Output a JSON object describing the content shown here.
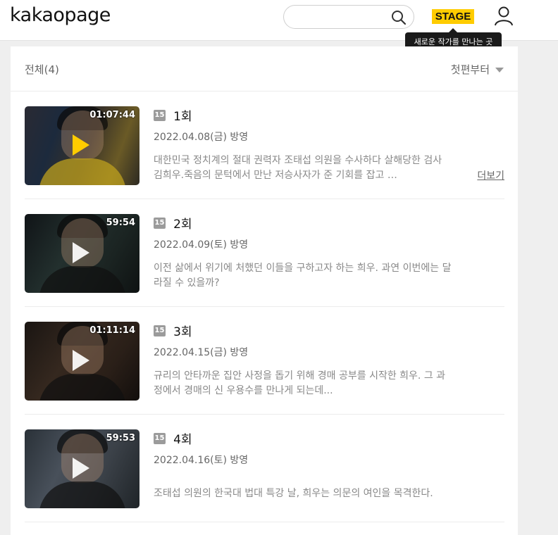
{
  "header": {
    "logo": "kakaopage",
    "search": {
      "value": "",
      "placeholder": ""
    },
    "stage_label": "STAGE",
    "stage_tooltip": "새로운 작가를 만나는 곳"
  },
  "list": {
    "count_label": "전체(4)",
    "sort_label": "첫편부터"
  },
  "episodes": [
    {
      "duration": "01:07:44",
      "age": "15",
      "title": "1회",
      "date": "2022.04.08(금) 방영",
      "description": "대한민국 정치계의 절대 권력자 조태섭 의원을 수사하다 살해당한 검사 김희우.죽음의 문턱에서 만난 저승사자가 준 기회를 잡고 …",
      "more_label": "더보기"
    },
    {
      "duration": "59:54",
      "age": "15",
      "title": "2회",
      "date": "2022.04.09(토) 방영",
      "description": "이전 삶에서 위기에 처했던 이들을 구하고자 하는 희우. 과연 이번에는 달라질 수 있을까?"
    },
    {
      "duration": "01:11:14",
      "age": "15",
      "title": "3회",
      "date": "2022.04.15(금) 방영",
      "description": "규리의 안타까운 집안 사정을 돕기 위해 경매 공부를 시작한 희우. 그 과정에서 경매의 신 우용수를 만나게 되는데..."
    },
    {
      "duration": "59:53",
      "age": "15",
      "title": "4회",
      "date": "2022.04.16(토) 방영",
      "description": "조태섭 의원의 한국대 법대 특강 날, 희우는 의문의 여인을 목격한다."
    }
  ],
  "colors": {
    "accent": "#ffcc00",
    "background": "#efefef"
  }
}
